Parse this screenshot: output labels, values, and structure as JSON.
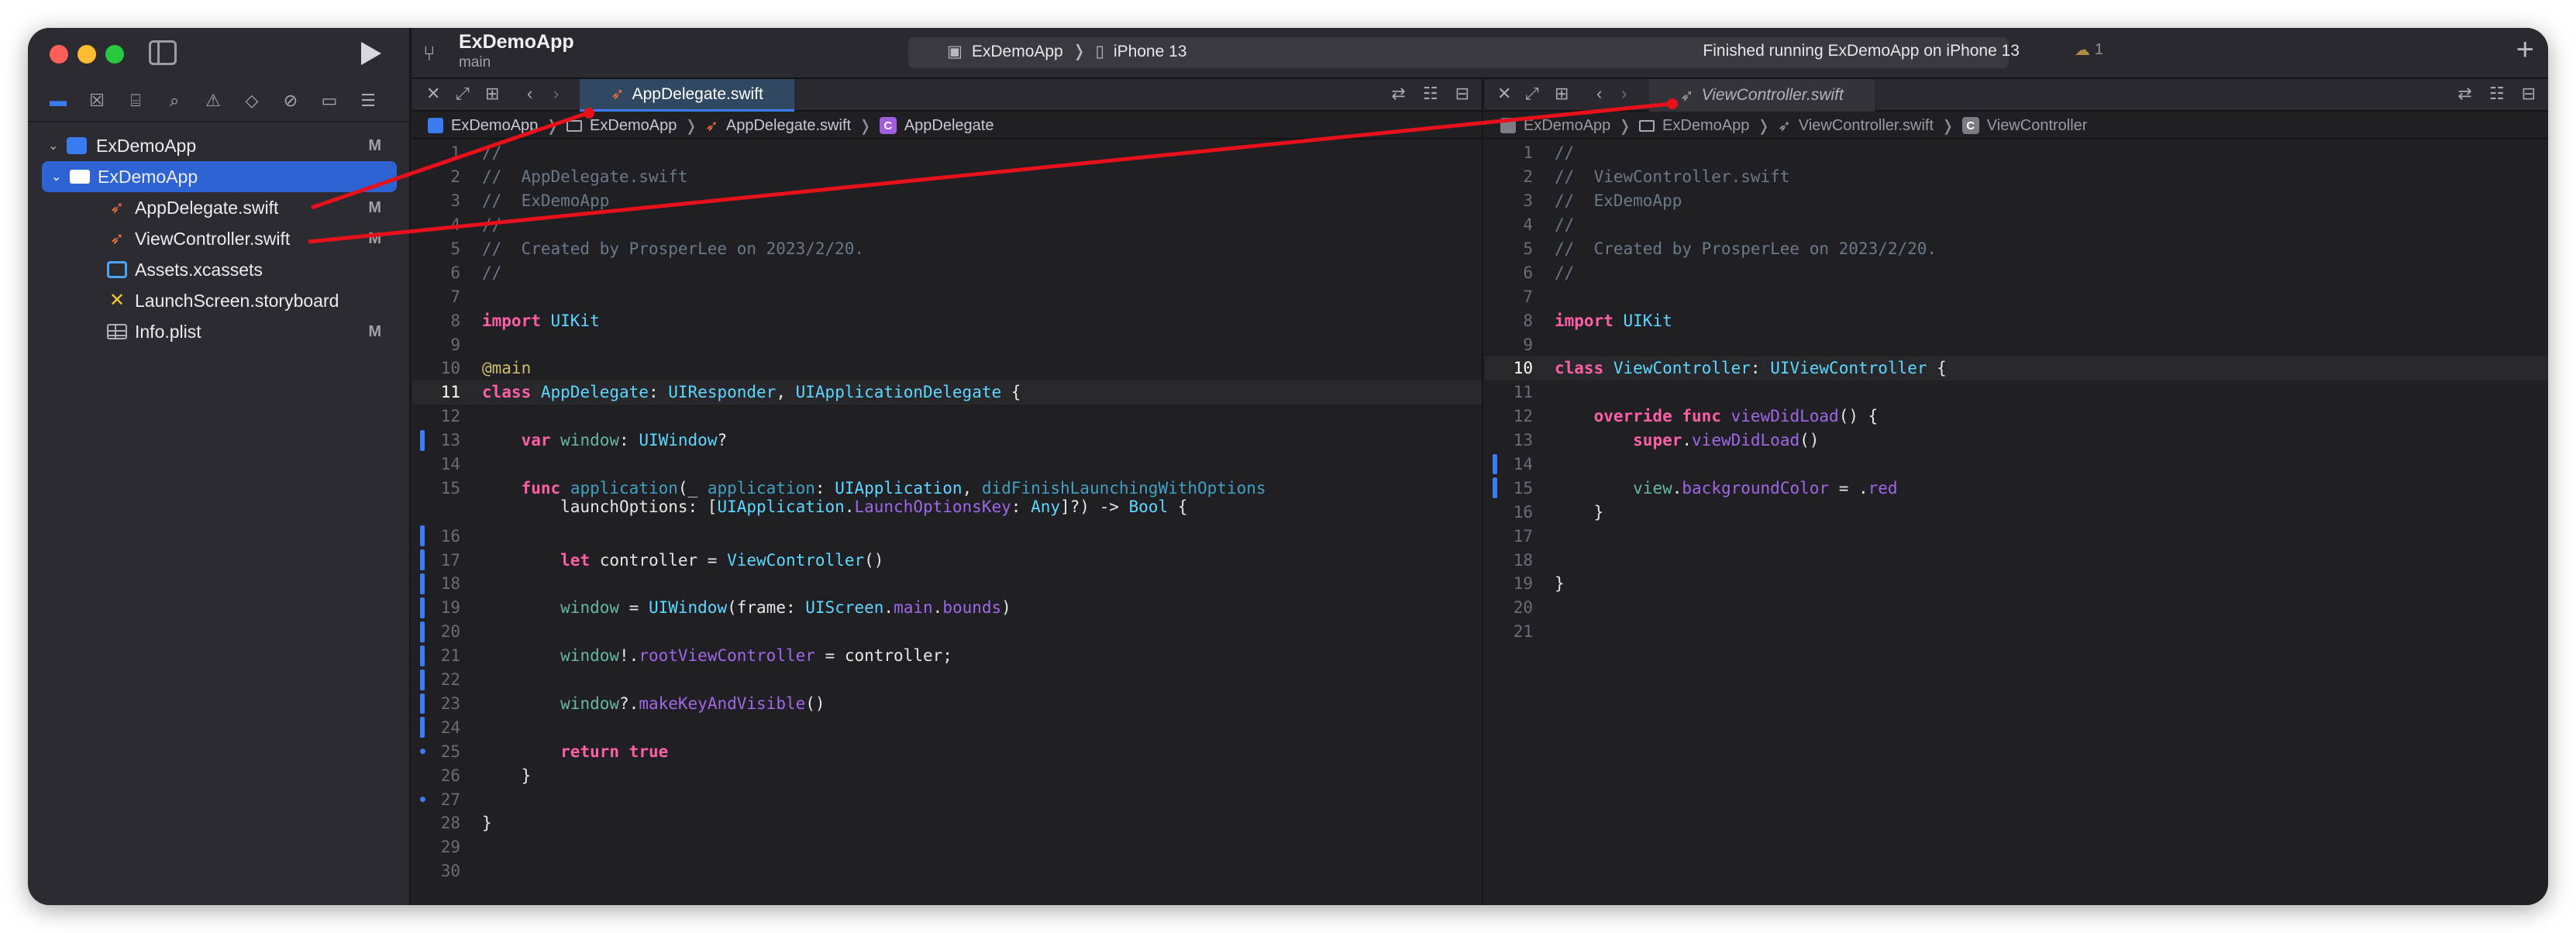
{
  "window": {
    "title": "ExDemoApp",
    "branch": "main",
    "scheme_target": "ExDemoApp",
    "scheme_device": "iPhone 13",
    "status": "Finished running ExDemoApp on iPhone 13",
    "warning_count": "1"
  },
  "sidebar": {
    "items": [
      {
        "label": "ExDemoApp",
        "badge": "M"
      },
      {
        "label": "ExDemoApp",
        "badge": ""
      },
      {
        "label": "AppDelegate.swift",
        "badge": "M"
      },
      {
        "label": "ViewController.swift",
        "badge": "M"
      },
      {
        "label": "Assets.xcassets",
        "badge": ""
      },
      {
        "label": "LaunchScreen.storyboard",
        "badge": ""
      },
      {
        "label": "Info.plist",
        "badge": "M"
      }
    ]
  },
  "left_editor": {
    "tab": "AppDelegate.swift",
    "breadcrumb": [
      "ExDemoApp",
      "ExDemoApp",
      "AppDelegate.swift",
      "AppDelegate"
    ],
    "current_line": 11,
    "lines": [
      {
        "n": "1",
        "code": "//"
      },
      {
        "n": "2",
        "code": "//  AppDelegate.swift"
      },
      {
        "n": "3",
        "code": "//  ExDemoApp"
      },
      {
        "n": "4",
        "code": "//"
      },
      {
        "n": "5",
        "code": "//  Created by ProsperLee on 2023/2/20."
      },
      {
        "n": "6",
        "code": "//"
      },
      {
        "n": "7",
        "code": ""
      },
      {
        "n": "8",
        "code": "import UIKit"
      },
      {
        "n": "9",
        "code": ""
      },
      {
        "n": "10",
        "code": "@main"
      },
      {
        "n": "11",
        "code": "class AppDelegate: UIResponder, UIApplicationDelegate {"
      },
      {
        "n": "12",
        "code": ""
      },
      {
        "n": "13",
        "code": "    var window: UIWindow?"
      },
      {
        "n": "14",
        "code": ""
      },
      {
        "n": "15",
        "code": "    func application(_ application: UIApplication, didFinishLaunchingWithOptions\n        launchOptions: [UIApplication.LaunchOptionsKey: Any]?) -> Bool {"
      },
      {
        "n": "16",
        "code": ""
      },
      {
        "n": "17",
        "code": "        let controller = ViewController()"
      },
      {
        "n": "18",
        "code": ""
      },
      {
        "n": "19",
        "code": "        window = UIWindow(frame: UIScreen.main.bounds)"
      },
      {
        "n": "20",
        "code": ""
      },
      {
        "n": "21",
        "code": "        window!.rootViewController = controller;"
      },
      {
        "n": "22",
        "code": ""
      },
      {
        "n": "23",
        "code": "        window?.makeKeyAndVisible()"
      },
      {
        "n": "24",
        "code": ""
      },
      {
        "n": "25",
        "code": "        return true"
      },
      {
        "n": "26",
        "code": "    }"
      },
      {
        "n": "27",
        "code": ""
      },
      {
        "n": "28",
        "code": "}"
      },
      {
        "n": "29",
        "code": ""
      },
      {
        "n": "30",
        "code": ""
      }
    ]
  },
  "right_editor": {
    "tab": "ViewController.swift",
    "breadcrumb": [
      "ExDemoApp",
      "ExDemoApp",
      "ViewController.swift",
      "ViewController"
    ],
    "current_line": 10,
    "lines": [
      {
        "n": "1",
        "code": "//"
      },
      {
        "n": "2",
        "code": "//  ViewController.swift"
      },
      {
        "n": "3",
        "code": "//  ExDemoApp"
      },
      {
        "n": "4",
        "code": "//"
      },
      {
        "n": "5",
        "code": "//  Created by ProsperLee on 2023/2/20."
      },
      {
        "n": "6",
        "code": "//"
      },
      {
        "n": "7",
        "code": ""
      },
      {
        "n": "8",
        "code": "import UIKit"
      },
      {
        "n": "9",
        "code": ""
      },
      {
        "n": "10",
        "code": "class ViewController: UIViewController {"
      },
      {
        "n": "11",
        "code": ""
      },
      {
        "n": "12",
        "code": "    override func viewDidLoad() {"
      },
      {
        "n": "13",
        "code": "        super.viewDidLoad()"
      },
      {
        "n": "14",
        "code": ""
      },
      {
        "n": "15",
        "code": "        view.backgroundColor = .red"
      },
      {
        "n": "16",
        "code": "    }"
      },
      {
        "n": "17",
        "code": ""
      },
      {
        "n": "18",
        "code": ""
      },
      {
        "n": "19",
        "code": "}"
      },
      {
        "n": "20",
        "code": ""
      },
      {
        "n": "21",
        "code": ""
      }
    ]
  },
  "colors": {
    "accent": "#3b7cf5",
    "annotation_arrow": "#e8101a",
    "keyword": "#fc5fa3",
    "comment": "#6c7986"
  }
}
